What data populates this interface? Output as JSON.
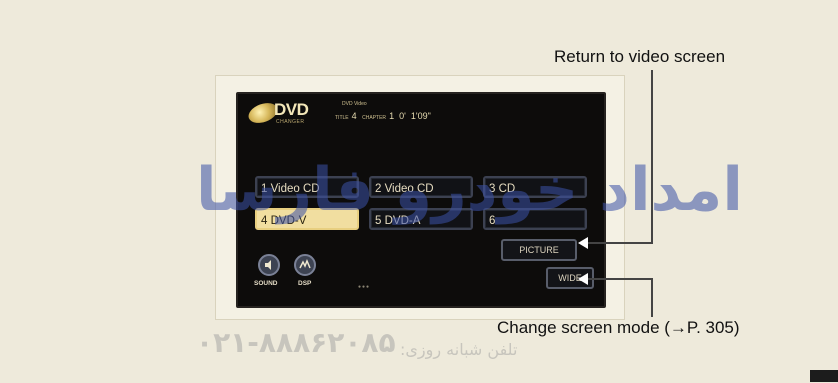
{
  "dvd_screen": {
    "logo": {
      "text": "DVD",
      "subtext": "CHANGER"
    },
    "info": {
      "top_label": "DVD Video",
      "title_label": "TITLE",
      "title_value": "4",
      "chapter_label": "CHAPTER",
      "chapter_value": "1",
      "time_minutes": "0'",
      "time_total": "1'09\""
    },
    "discs": [
      {
        "label": "1 Video CD",
        "active": false
      },
      {
        "label": "2 Video CD",
        "active": false
      },
      {
        "label": "3 CD",
        "active": false
      },
      {
        "label": "4 DVD-V",
        "active": true
      },
      {
        "label": "5 DVD-A",
        "active": false
      },
      {
        "label": "6",
        "active": false
      }
    ],
    "picture_label": "PICTURE",
    "wide_label": "WIDE",
    "sound_label": "SOUND",
    "dsp_label": "DSP"
  },
  "callouts": {
    "return": "Return to video screen",
    "change": "Change screen mode (→P. 305)"
  },
  "watermark": {
    "brand": "امداد خودرو فارسا",
    "phone": "۰۲۱-۸۸۸۶۲۰۸۵",
    "phone_label": "تلفن شبانه روزی:"
  }
}
